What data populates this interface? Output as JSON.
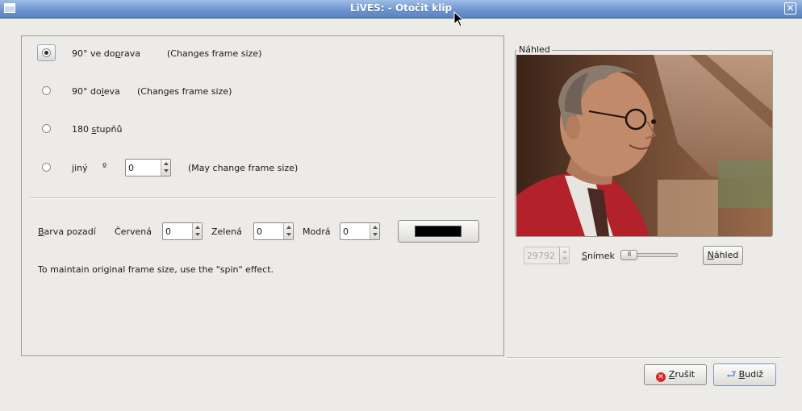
{
  "window": {
    "title": "LiVES: - Otočit klip",
    "close_glyph": "✕"
  },
  "rotation": {
    "option_right_pre": "90° ve do",
    "option_right_mnemonic": "p",
    "option_right_post": "rava",
    "option_right_note": "(Changes frame size)",
    "option_left_pre": "90° do",
    "option_left_mnemonic": "l",
    "option_left_post": "eva",
    "option_left_note": "(Changes frame size)",
    "option_180_pre": "180 ",
    "option_180_mnemonic": "s",
    "option_180_post": "tupňů",
    "option_other_mnemonic": "j",
    "option_other_post": "iný",
    "degree_symbol": "º",
    "other_angle_value": "0",
    "other_note": "(May change frame size)",
    "selected": "90° ve doprava"
  },
  "background": {
    "label_mnemonic": "B",
    "label_post": "arva pozadí",
    "red_label": "Červená",
    "red_value": "0",
    "green_label": "Zelená",
    "green_value": "0",
    "blue_label": "Modrá",
    "blue_value": "0",
    "swatch_color": "#000000"
  },
  "hint": "To maintain original frame size, use the \"spin\" effect.",
  "preview": {
    "frame_label": "Náhled",
    "frame_number": "29792",
    "frame_label_mnemonic": "S",
    "frame_label_post": "nímek",
    "button_mnemonic": "N",
    "button_post": "áhled",
    "slider_level": 0
  },
  "actions": {
    "cancel_mnemonic": "Z",
    "cancel_post": "rušit",
    "ok_mnemonic": "B",
    "ok_post": "udiž"
  },
  "colors": {
    "titlebar": "#6f95cf",
    "cancel_icon": "#d8262a",
    "ok_icon": "#6a92c8"
  }
}
